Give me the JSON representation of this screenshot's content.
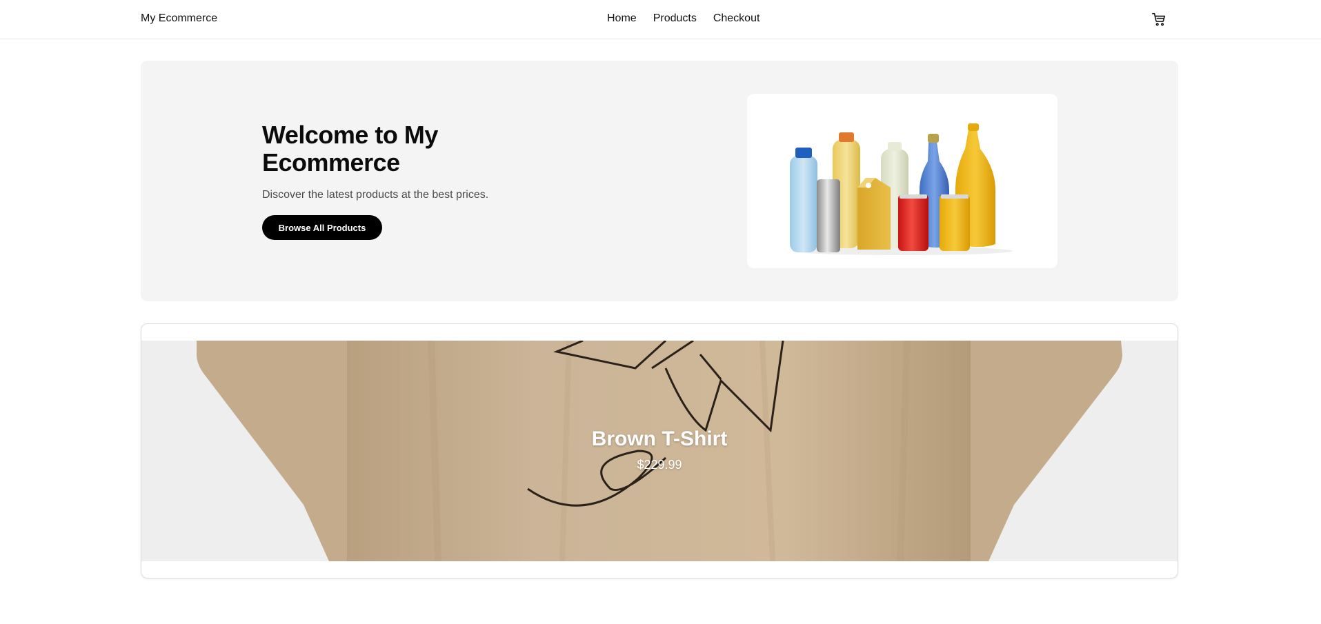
{
  "header": {
    "brand": "My Ecommerce",
    "nav": [
      {
        "label": "Home"
      },
      {
        "label": "Products"
      },
      {
        "label": "Checkout"
      }
    ],
    "cart_icon": "cart-icon"
  },
  "hero": {
    "title": "Welcome to My Ecommerce",
    "subtitle": "Discover the latest products at the best prices.",
    "button_label": "Browse All Products",
    "image_icon": "beverage-bottles-image"
  },
  "featured_product": {
    "name": "Brown T-Shirt",
    "price": "$229.99",
    "image_icon": "brown-tshirt-image",
    "colors": {
      "shirt": "#cbb497",
      "background": "#eeeeee"
    }
  },
  "colors": {
    "button_bg": "#000000",
    "hero_bg": "#f4f4f4"
  }
}
